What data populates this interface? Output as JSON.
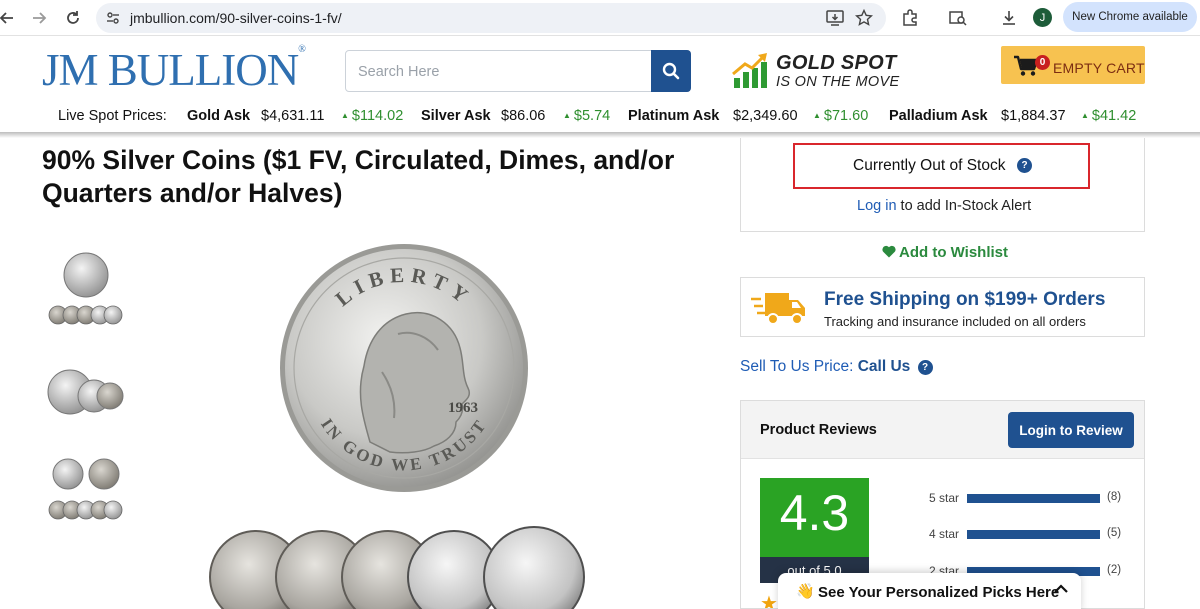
{
  "browser": {
    "url": "jmbullion.com/90-silver-coins-1-fv/",
    "profile_initial": "J",
    "update_label": "New Chrome available"
  },
  "header": {
    "logo_text": "JM BULLION",
    "logo_mark": "®",
    "search_placeholder": "Search Here",
    "promo_title": "GOLD SPOT",
    "promo_subtitle": "IS ON THE MOVE",
    "cart_count": "0",
    "cart_label": "EMPTY CART"
  },
  "spot_prices": {
    "label": "Live Spot Prices:",
    "items": [
      {
        "metal": "Gold Ask",
        "price": "$4,631.11",
        "change": "$114.02"
      },
      {
        "metal": "Silver Ask",
        "price": "$86.06",
        "change": "$5.74"
      },
      {
        "metal": "Platinum Ask",
        "price": "$2,349.60",
        "change": "$71.60"
      },
      {
        "metal": "Palladium Ask",
        "price": "$1,884.37",
        "change": "$41.42"
      }
    ]
  },
  "product": {
    "title": "90% Silver Coins ($1 FV, Circulated, Dimes, and/or Quarters and/or Halves)",
    "coin_inscription_top": "LIBERTY",
    "coin_inscription_bottom": "IN GOD WE TRUST",
    "coin_year": "1963"
  },
  "purchase": {
    "stock_status": "Currently Out of Stock",
    "login_link": "Log in",
    "login_suffix": " to add In-Stock Alert",
    "wishlist_label": "Add to Wishlist",
    "shipping_title": "Free Shipping on $199+ Orders",
    "shipping_subtitle": "Tracking and insurance included on all orders",
    "sell_label": "Sell To Us Price: ",
    "sell_cta": "Call Us"
  },
  "reviews": {
    "title": "Product Reviews",
    "button_label": "Login to Review",
    "average": "4.3",
    "average_caption": "out of 5.0",
    "distribution": [
      {
        "label": "5 star",
        "count": "(8)",
        "fraction": 1.0
      },
      {
        "label": "4 star",
        "count": "(5)",
        "fraction": 1.0
      },
      {
        "label": "2 star",
        "count": "(2)",
        "fraction": 1.0
      }
    ]
  },
  "picks_banner": {
    "emoji": "👋",
    "label": "See Your Personalized Picks Here"
  },
  "colors": {
    "brand_blue": "#1f5190",
    "accent_yellow": "#f7c250",
    "positive_green": "#2f8f2f",
    "score_green": "#2aa324",
    "alert_red": "#d9262c"
  }
}
